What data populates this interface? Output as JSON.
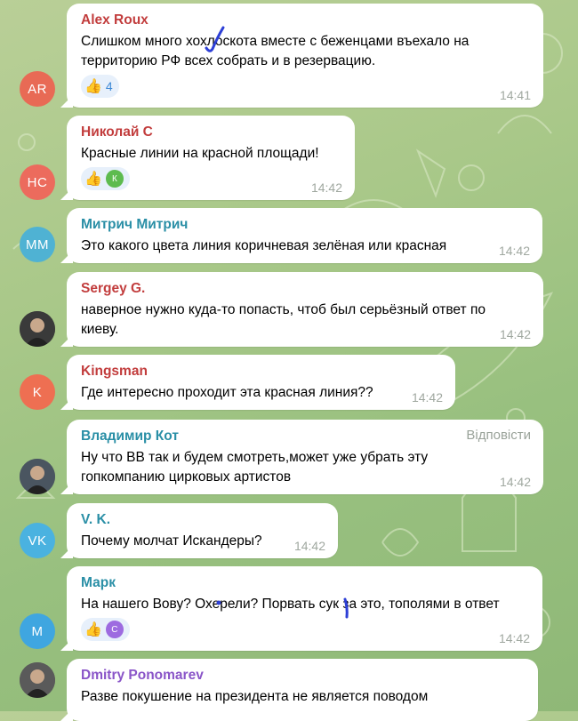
{
  "reply_label": "Відповісти",
  "messages": [
    {
      "sender": "Alex Roux",
      "sender_color": "#c23d3d",
      "avatar": "AR",
      "avatar_color": "#e86a55",
      "lines": [
        "Слишком много хохлоскота вместе с беженцами въехало на",
        "территорию РФ всех собрать и в резервацию."
      ],
      "reaction": {
        "emoji": "👍",
        "count": "4"
      },
      "time": "14:41"
    },
    {
      "sender": "Николай С",
      "sender_color": "#c23d3d",
      "avatar": "НС",
      "avatar_color": "#ec6b5d",
      "lines": [
        "Красные линии на красной площади!"
      ],
      "reaction": {
        "emoji": "👍",
        "user": "К",
        "user_color": "#5dbb4f"
      },
      "time": "14:42"
    },
    {
      "sender": "Митрич Митрич",
      "sender_color": "#2a8fa6",
      "avatar": "ММ",
      "avatar_color": "#4fb2d3",
      "lines": [
        "Это какого цвета линия коричневая зелёная или красная"
      ],
      "time": "14:42"
    },
    {
      "sender": "Sergey G.",
      "sender_color": "#c23d3d",
      "avatar": "photo",
      "avatar_color": "#3a3a3a",
      "lines": [
        "наверное нужно куда-то попасть, чтоб был серьёзный ответ по",
        "киеву."
      ],
      "time": "14:42"
    },
    {
      "sender": "Kingsman",
      "sender_color": "#c23d3d",
      "avatar": "K",
      "avatar_color": "#ee6f52",
      "lines": [
        "Где интересно проходит эта красная линия??"
      ],
      "time": "14:42"
    },
    {
      "sender": "Владимир Кот",
      "sender_color": "#2a8fa6",
      "avatar": "photo",
      "avatar_color": "#4a5560",
      "lines": [
        "Ну что ВВ так и будем смотреть,может уже убрать эту",
        "гопкомпанию цирковых артистов"
      ],
      "time": "14:42",
      "show_reply": true
    },
    {
      "sender": "V. K.",
      "sender_color": "#2a8fa6",
      "avatar": "VK",
      "avatar_color": "#4ab2e0",
      "lines": [
        "Почему молчат Искандеры?"
      ],
      "time": "14:42"
    },
    {
      "sender": "Марк",
      "sender_color": "#2a8fa6",
      "avatar": "М",
      "avatar_color": "#3fa6e0",
      "lines": [
        "На нашего Вову? Охерели? Порвать сук за это, тополями в ответ"
      ],
      "reaction": {
        "emoji": "👍",
        "user": "С",
        "user_color": "#9d6be0"
      },
      "time": "14:42"
    },
    {
      "sender": "Dmitry Ponomarev",
      "sender_color": "#8a55c8",
      "avatar": "photo",
      "avatar_color": "#5a5a5a",
      "lines": [
        "Разве покушение на президента не является поводом"
      ]
    }
  ]
}
